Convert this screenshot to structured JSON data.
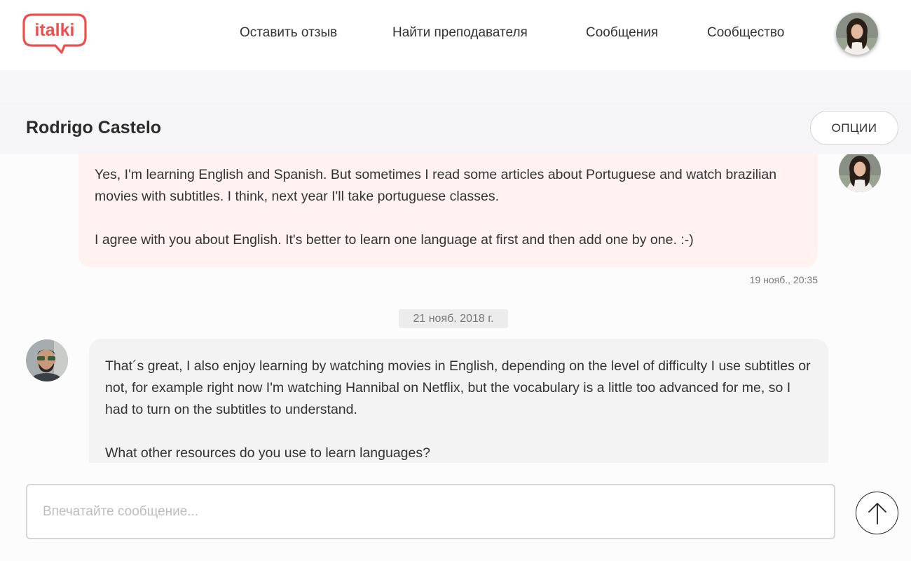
{
  "brand": {
    "logo_text": "italki",
    "accent_color": "#f04e4e"
  },
  "nav": {
    "items": [
      {
        "label": "Оставить отзыв"
      },
      {
        "label": "Найти преподавателя"
      },
      {
        "label": "Сообщения"
      },
      {
        "label": "Сообщество"
      }
    ],
    "avatar_icon": "user-avatar-icon"
  },
  "conversation": {
    "partner_name": "Rodrigo Castelo",
    "options_label": "ОПЦИИ"
  },
  "messages": [
    {
      "sender": "me",
      "paragraphs": [
        "Yes, I'm learning English and Spanish. But sometimes I read some articles about Portuguese and watch brazilian movies with subtitles. I think, next year I'll take portuguese classes.",
        "I agree with you about English. It's better to learn one language at first and then add one by one. :-)"
      ],
      "timestamp": "19 нояб., 20:35",
      "bubble_color": "#fff2f0"
    },
    {
      "sender": "partner",
      "paragraphs": [
        "That´s great, I also enjoy learning by watching movies in English, depending on the level of difficulty I use subtitles or not, for example right now I'm watching Hannibal on Netflix, but the vocabulary is a little too advanced for me, so I had to turn on the subtitles to understand.",
        "What other resources do you use to learn languages?"
      ],
      "bubble_color": "#f3f3f3"
    }
  ],
  "date_separator": "21 нояб. 2018 г.",
  "composer": {
    "placeholder": "Впечатайте сообщение...",
    "value": "",
    "send_icon": "arrow-up-icon"
  }
}
